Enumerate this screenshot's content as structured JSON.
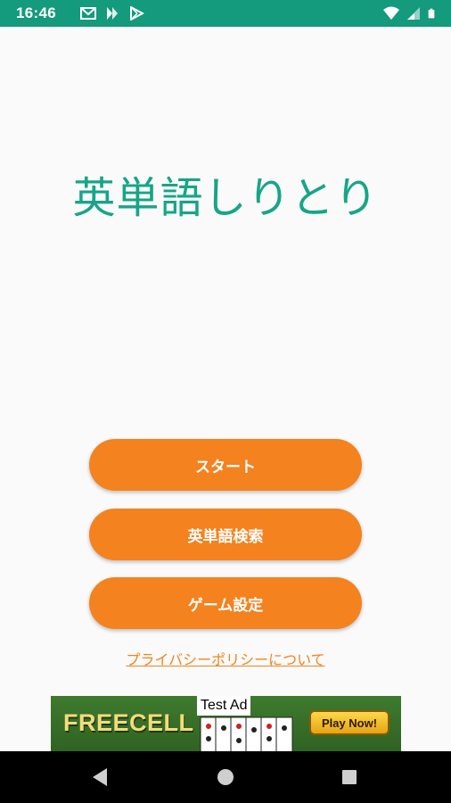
{
  "status_bar": {
    "time": "16:46",
    "left_icons": [
      "gmail-icon",
      "kindle-icon",
      "play-store-icon"
    ],
    "right_icons": [
      "wifi-icon",
      "cellular-signal-icon",
      "battery-icon"
    ],
    "background": "#149a7c"
  },
  "main": {
    "title": "英単語しりとり",
    "title_color": "#16a587"
  },
  "buttons": {
    "start_label": "スタート",
    "search_label": "英単語検索",
    "settings_label": "ゲーム設定",
    "color": "#f4821f"
  },
  "privacy_link": "プライバシーポリシーについて",
  "ad": {
    "brand": "FREECELL",
    "label": "Test Ad",
    "cta": "Play Now!"
  },
  "nav_bar": {
    "icons": [
      "back-icon",
      "home-icon",
      "recent-apps-icon"
    ]
  }
}
